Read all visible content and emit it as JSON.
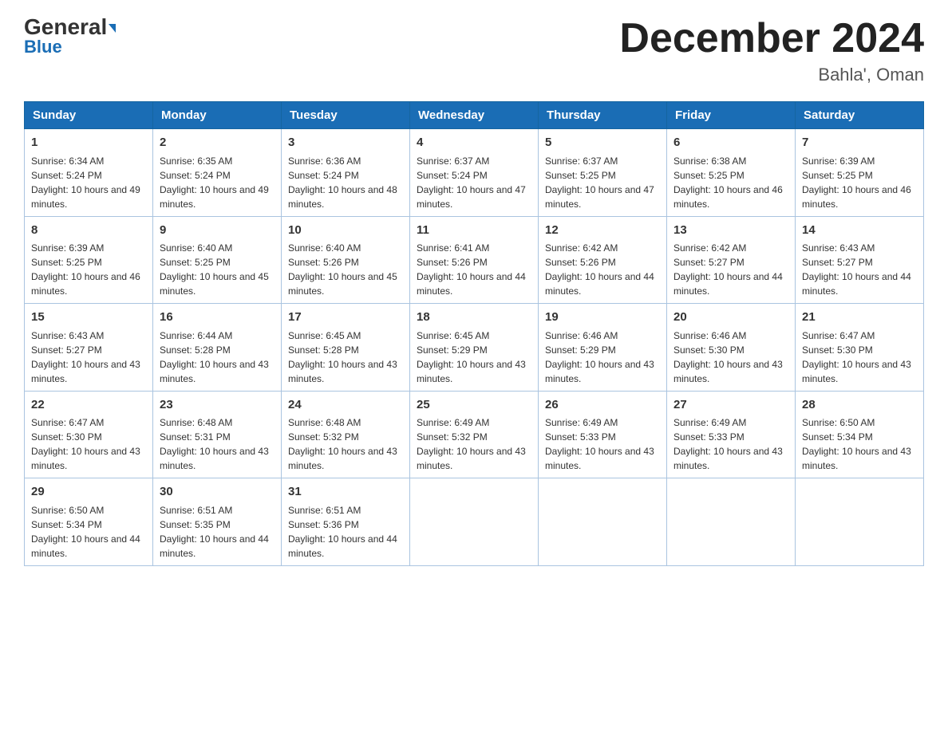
{
  "header": {
    "logo_general": "General",
    "logo_blue": "Blue",
    "month_title": "December 2024",
    "location": "Bahla', Oman"
  },
  "days_of_week": [
    "Sunday",
    "Monday",
    "Tuesday",
    "Wednesday",
    "Thursday",
    "Friday",
    "Saturday"
  ],
  "weeks": [
    [
      {
        "day": "1",
        "sunrise": "6:34 AM",
        "sunset": "5:24 PM",
        "daylight": "10 hours and 49 minutes."
      },
      {
        "day": "2",
        "sunrise": "6:35 AM",
        "sunset": "5:24 PM",
        "daylight": "10 hours and 49 minutes."
      },
      {
        "day": "3",
        "sunrise": "6:36 AM",
        "sunset": "5:24 PM",
        "daylight": "10 hours and 48 minutes."
      },
      {
        "day": "4",
        "sunrise": "6:37 AM",
        "sunset": "5:24 PM",
        "daylight": "10 hours and 47 minutes."
      },
      {
        "day": "5",
        "sunrise": "6:37 AM",
        "sunset": "5:25 PM",
        "daylight": "10 hours and 47 minutes."
      },
      {
        "day": "6",
        "sunrise": "6:38 AM",
        "sunset": "5:25 PM",
        "daylight": "10 hours and 46 minutes."
      },
      {
        "day": "7",
        "sunrise": "6:39 AM",
        "sunset": "5:25 PM",
        "daylight": "10 hours and 46 minutes."
      }
    ],
    [
      {
        "day": "8",
        "sunrise": "6:39 AM",
        "sunset": "5:25 PM",
        "daylight": "10 hours and 46 minutes."
      },
      {
        "day": "9",
        "sunrise": "6:40 AM",
        "sunset": "5:25 PM",
        "daylight": "10 hours and 45 minutes."
      },
      {
        "day": "10",
        "sunrise": "6:40 AM",
        "sunset": "5:26 PM",
        "daylight": "10 hours and 45 minutes."
      },
      {
        "day": "11",
        "sunrise": "6:41 AM",
        "sunset": "5:26 PM",
        "daylight": "10 hours and 44 minutes."
      },
      {
        "day": "12",
        "sunrise": "6:42 AM",
        "sunset": "5:26 PM",
        "daylight": "10 hours and 44 minutes."
      },
      {
        "day": "13",
        "sunrise": "6:42 AM",
        "sunset": "5:27 PM",
        "daylight": "10 hours and 44 minutes."
      },
      {
        "day": "14",
        "sunrise": "6:43 AM",
        "sunset": "5:27 PM",
        "daylight": "10 hours and 44 minutes."
      }
    ],
    [
      {
        "day": "15",
        "sunrise": "6:43 AM",
        "sunset": "5:27 PM",
        "daylight": "10 hours and 43 minutes."
      },
      {
        "day": "16",
        "sunrise": "6:44 AM",
        "sunset": "5:28 PM",
        "daylight": "10 hours and 43 minutes."
      },
      {
        "day": "17",
        "sunrise": "6:45 AM",
        "sunset": "5:28 PM",
        "daylight": "10 hours and 43 minutes."
      },
      {
        "day": "18",
        "sunrise": "6:45 AM",
        "sunset": "5:29 PM",
        "daylight": "10 hours and 43 minutes."
      },
      {
        "day": "19",
        "sunrise": "6:46 AM",
        "sunset": "5:29 PM",
        "daylight": "10 hours and 43 minutes."
      },
      {
        "day": "20",
        "sunrise": "6:46 AM",
        "sunset": "5:30 PM",
        "daylight": "10 hours and 43 minutes."
      },
      {
        "day": "21",
        "sunrise": "6:47 AM",
        "sunset": "5:30 PM",
        "daylight": "10 hours and 43 minutes."
      }
    ],
    [
      {
        "day": "22",
        "sunrise": "6:47 AM",
        "sunset": "5:30 PM",
        "daylight": "10 hours and 43 minutes."
      },
      {
        "day": "23",
        "sunrise": "6:48 AM",
        "sunset": "5:31 PM",
        "daylight": "10 hours and 43 minutes."
      },
      {
        "day": "24",
        "sunrise": "6:48 AM",
        "sunset": "5:32 PM",
        "daylight": "10 hours and 43 minutes."
      },
      {
        "day": "25",
        "sunrise": "6:49 AM",
        "sunset": "5:32 PM",
        "daylight": "10 hours and 43 minutes."
      },
      {
        "day": "26",
        "sunrise": "6:49 AM",
        "sunset": "5:33 PM",
        "daylight": "10 hours and 43 minutes."
      },
      {
        "day": "27",
        "sunrise": "6:49 AM",
        "sunset": "5:33 PM",
        "daylight": "10 hours and 43 minutes."
      },
      {
        "day": "28",
        "sunrise": "6:50 AM",
        "sunset": "5:34 PM",
        "daylight": "10 hours and 43 minutes."
      }
    ],
    [
      {
        "day": "29",
        "sunrise": "6:50 AM",
        "sunset": "5:34 PM",
        "daylight": "10 hours and 44 minutes."
      },
      {
        "day": "30",
        "sunrise": "6:51 AM",
        "sunset": "5:35 PM",
        "daylight": "10 hours and 44 minutes."
      },
      {
        "day": "31",
        "sunrise": "6:51 AM",
        "sunset": "5:36 PM",
        "daylight": "10 hours and 44 minutes."
      },
      null,
      null,
      null,
      null
    ]
  ]
}
